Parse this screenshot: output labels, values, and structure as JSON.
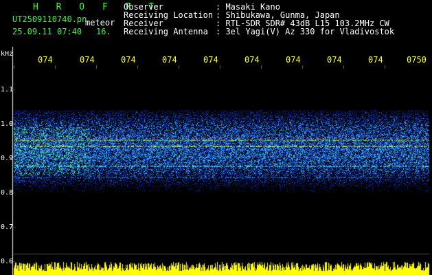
{
  "app": {
    "title": "H R O F F T",
    "filename": "UT2509110740.pn",
    "type_label": "meteor",
    "datetime": "25.09.11 07:40",
    "count": "16."
  },
  "info": [
    {
      "label": "Observer",
      "value": ": Masaki Kano"
    },
    {
      "label": "Receiving Location",
      "value": ": Shibukawa, Gunma, Japan"
    },
    {
      "label": "Receiver",
      "value": ": RTL-SDR SDR# 43dB L15 103.2MHz CW"
    },
    {
      "label": "Receiving Antenna",
      "value": ": 3el Yagi(V) Az 330 for Vladivostok"
    }
  ],
  "axis": {
    "unit": "kHz",
    "y_ticks": [
      "1.1",
      "1.0",
      "0.9",
      "0.8",
      "0.7",
      "0.6"
    ],
    "x_ticks": [
      "074",
      "074",
      "074",
      "074",
      "074",
      "074",
      "074",
      "074",
      "074",
      "0750"
    ]
  },
  "colors": {
    "background": "#000000",
    "header_green": "#33ff33",
    "header_white": "#ffffff",
    "time_yellow": "#ffff33",
    "bottom_trace": "#ffff00"
  }
}
